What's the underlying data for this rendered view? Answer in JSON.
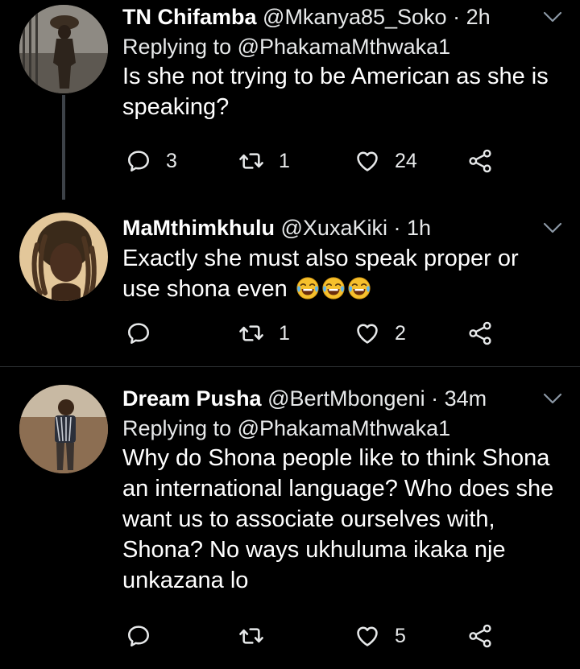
{
  "tweets": [
    {
      "name": "TN Chifamba",
      "handle": "@Mkanya85_Soko",
      "dot": "·",
      "time": "2h",
      "reply_prefix": "Replying to",
      "reply_to": "@PhakamaMthwaka1",
      "text": "Is she not trying to be American as she is speaking?",
      "replies": "3",
      "retweets": "1",
      "likes": "24"
    },
    {
      "name": "MaMthimkhulu",
      "handle": "@XuxaKiki",
      "dot": "·",
      "time": "1h",
      "text": "Exactly she must also speak proper or use shona even",
      "emoji_count": 3,
      "replies": "",
      "retweets": "1",
      "likes": "2"
    },
    {
      "name": "Dream Pusha",
      "handle": "@BertMbongeni",
      "dot": "·",
      "time": "34m",
      "reply_prefix": "Replying to",
      "reply_to": "@PhakamaMthwaka1",
      "text": "Why do Shona people like to think Shona an international language? Who does she want us to associate ourselves with, Shona? No ways ukhuluma ikaka nje unkazana lo",
      "replies": "",
      "retweets": "",
      "likes": "5"
    }
  ],
  "icons": {
    "reply": "reply-icon",
    "retweet": "retweet-icon",
    "like": "heart-icon",
    "share": "share-icon",
    "more": "chevron-down-icon",
    "emoji": "face-with-tears-of-joy-icon"
  },
  "colors": {
    "background": "#000000",
    "text": "#ffffff",
    "divider": "#2f3336",
    "thread_line": "#3d4248",
    "emoji": "#f6c02c"
  }
}
